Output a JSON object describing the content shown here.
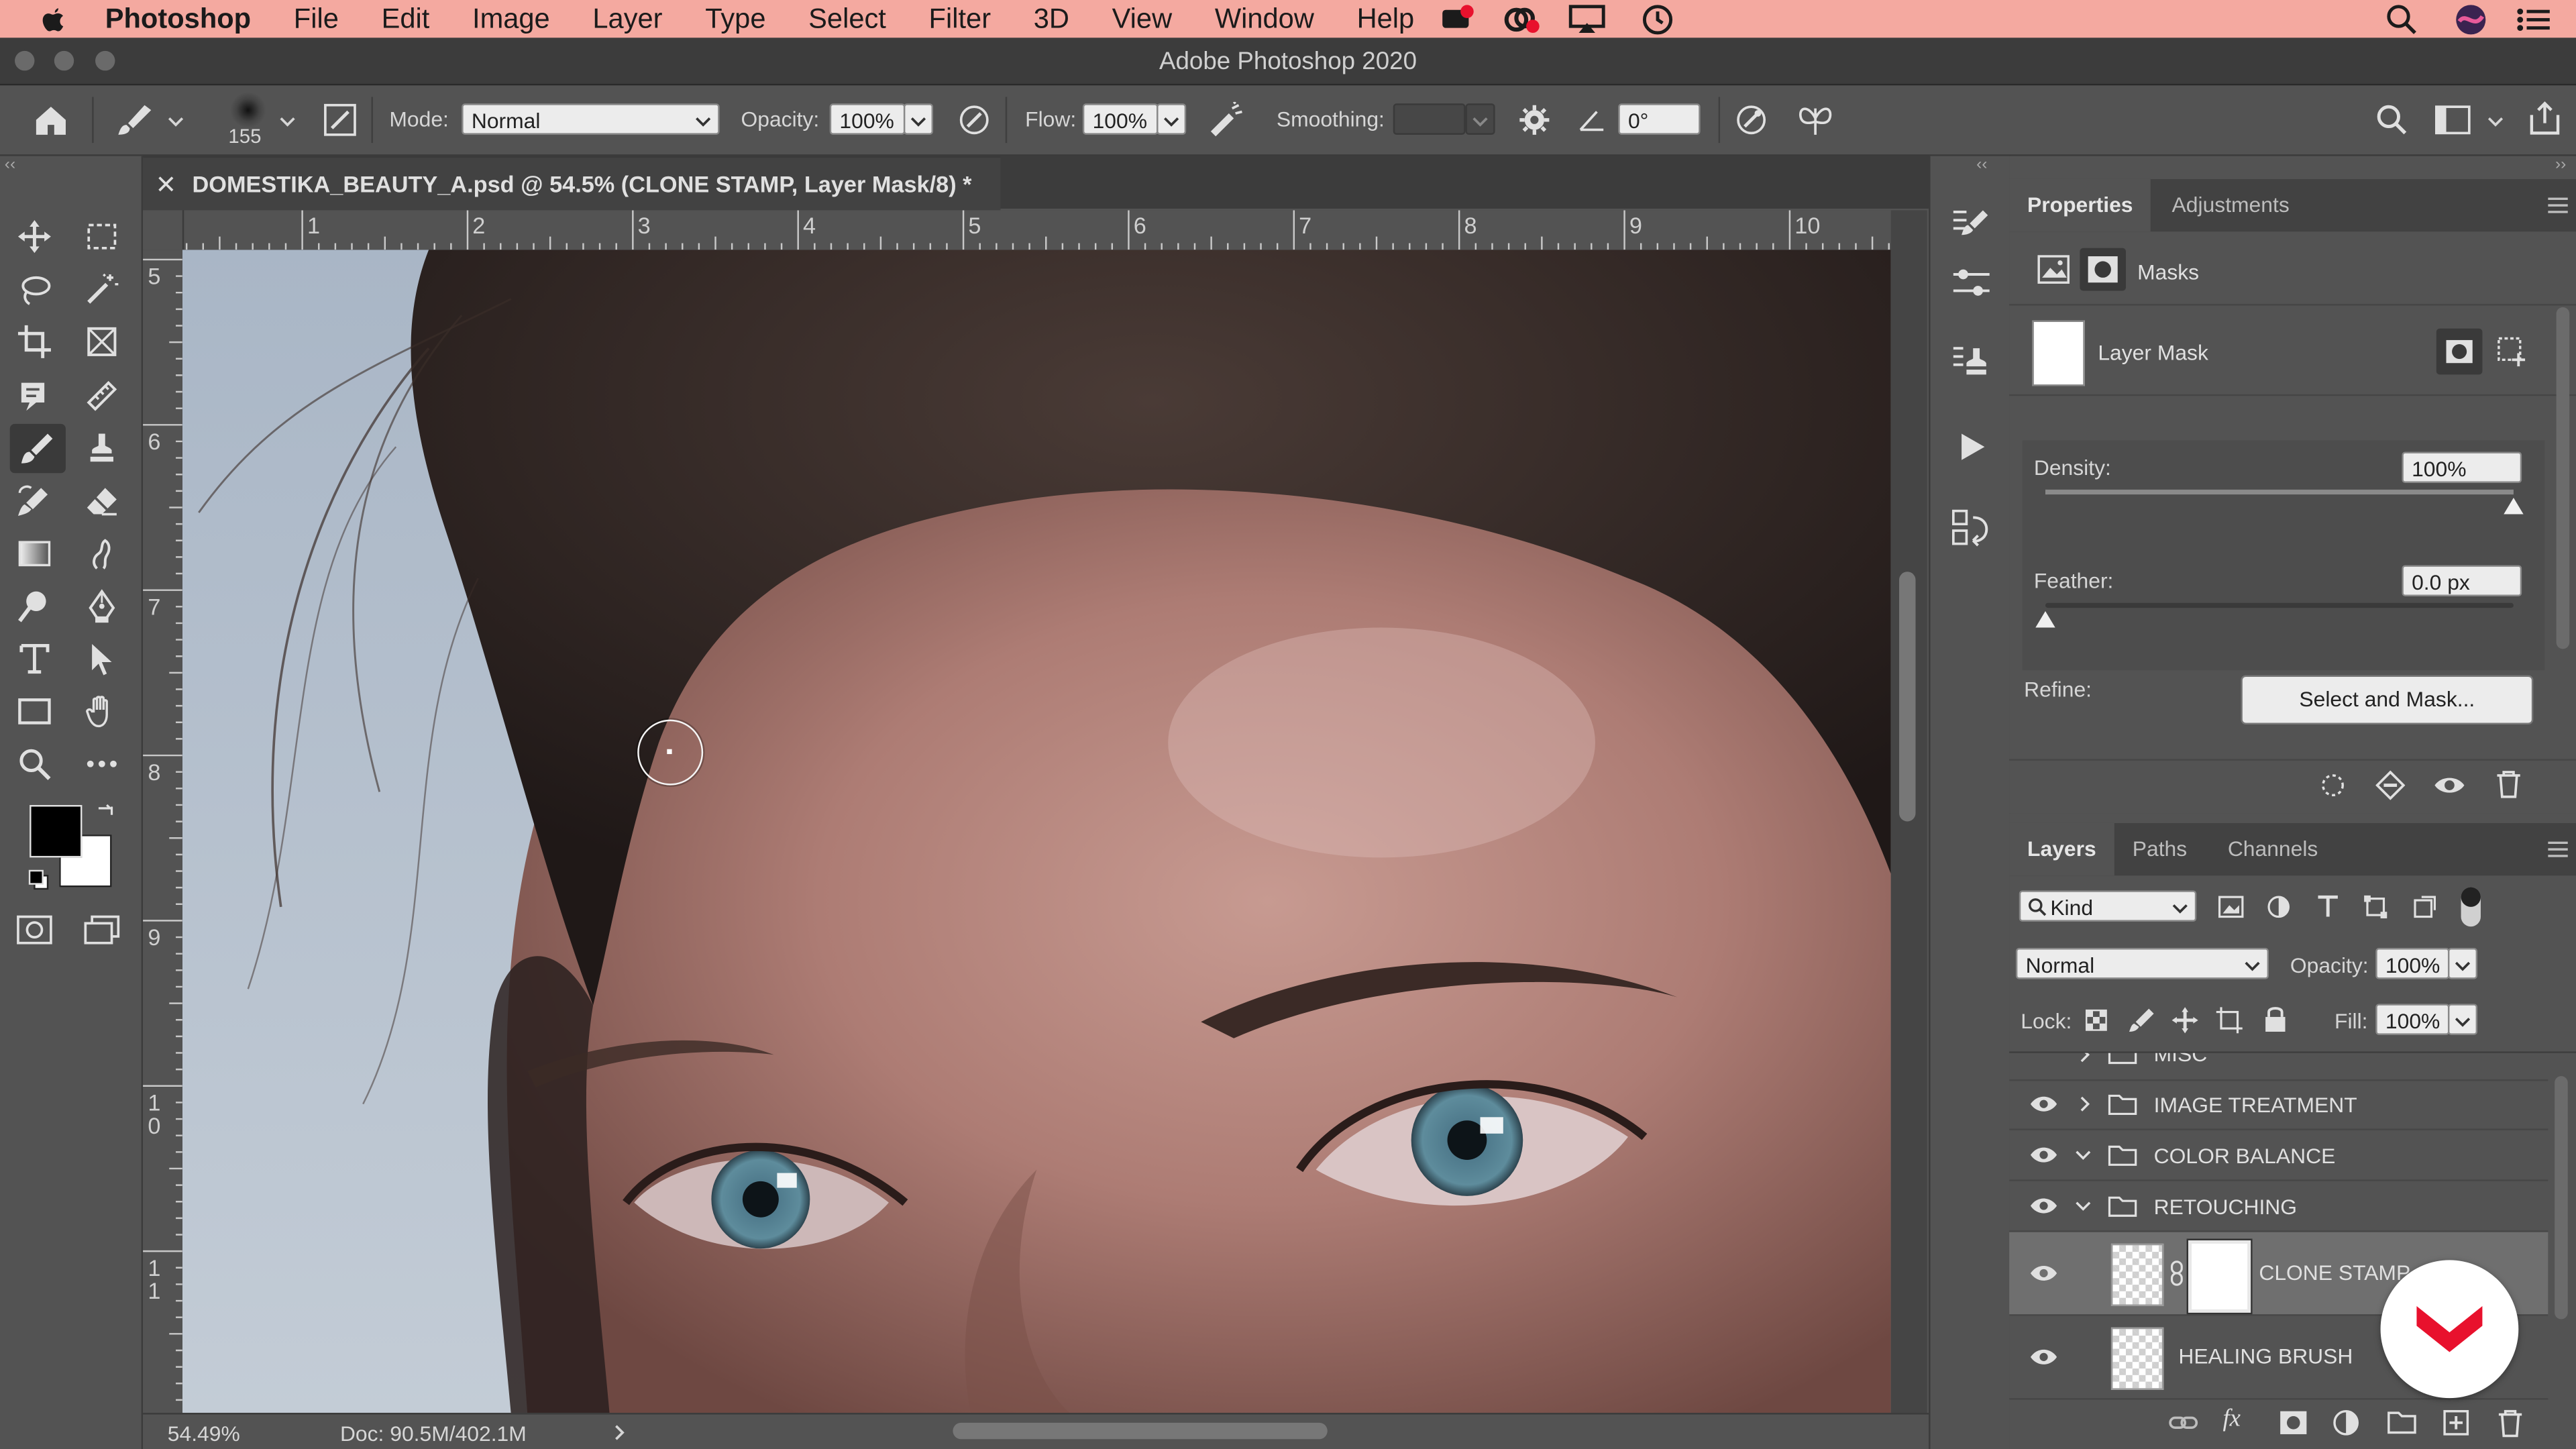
{
  "menubar": {
    "app": "Photoshop",
    "items": [
      "File",
      "Edit",
      "Image",
      "Layer",
      "Type",
      "Select",
      "Filter",
      "3D",
      "View",
      "Window",
      "Help"
    ]
  },
  "window": {
    "title": "Adobe Photoshop 2020"
  },
  "options": {
    "brush_size": "155",
    "mode_label": "Mode:",
    "mode_value": "Normal",
    "opacity_label": "Opacity:",
    "opacity_value": "100%",
    "flow_label": "Flow:",
    "flow_value": "100%",
    "smoothing_label": "Smoothing:",
    "smoothing_value": "",
    "angle_value": "0°"
  },
  "document": {
    "tab_title": "DOMESTIKA_BEAUTY_A.psd @ 54.5% (CLONE STAMP, Layer Mask/8) *",
    "zoom": "54.49%",
    "doc_size": "Doc: 90.5M/402.1M"
  },
  "rulers": {
    "h": [
      "1",
      "2",
      "3",
      "4",
      "5",
      "6",
      "7",
      "8",
      "9",
      "10"
    ],
    "v": [
      "5",
      "6",
      "7",
      "8",
      "9",
      "10",
      "11"
    ]
  },
  "properties": {
    "tabs": [
      "Properties",
      "Adjustments"
    ],
    "section": "Masks",
    "mask_name": "Layer Mask",
    "density_label": "Density:",
    "density_value": "100%",
    "density_level": 1.0,
    "feather_label": "Feather:",
    "feather_value": "0.0 px",
    "feather_level": 0.0,
    "refine_label": "Refine:",
    "select_mask_button": "Select and Mask..."
  },
  "layers_panel": {
    "tabs": [
      "Layers",
      "Paths",
      "Channels"
    ],
    "filter_kind": "Kind",
    "blend_mode": "Normal",
    "opacity_label": "Opacity:",
    "opacity_value": "100%",
    "lock_label": "Lock:",
    "fill_label": "Fill:",
    "fill_value": "100%",
    "layers": [
      {
        "name": "MISC",
        "type": "group"
      },
      {
        "name": "IMAGE TREATMENT",
        "type": "group"
      },
      {
        "name": "COLOR BALANCE",
        "type": "group"
      },
      {
        "name": "RETOUCHING",
        "type": "group"
      },
      {
        "name": "CLONE STAMP",
        "type": "layer"
      },
      {
        "name": "HEALING BRUSH",
        "type": "layer"
      }
    ]
  },
  "colors": {
    "menubar_bg": "#f4a9a0",
    "panel_bg": "#535353",
    "foreground": "#000000",
    "background": "#ffffff",
    "brand": "#e8112d"
  }
}
